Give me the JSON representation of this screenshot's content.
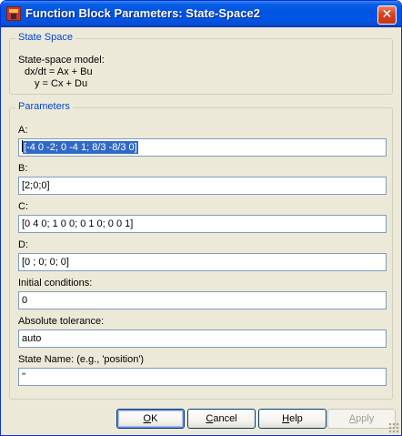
{
  "window": {
    "title": "Function Block Parameters: State-Space2",
    "close_label": "✕"
  },
  "state_space_group": {
    "legend": "State Space",
    "description_lines": [
      "State-space model:",
      "dx/dt = Ax + Bu",
      "y = Cx + Du"
    ]
  },
  "parameters_group": {
    "legend": "Parameters",
    "fields": [
      {
        "label": "A:",
        "value": "[-4 0 -2; 0 -4 1; 8/3 -8/3 0]",
        "selected": true
      },
      {
        "label": "B:",
        "value": "[2;0;0]"
      },
      {
        "label": "C:",
        "value": "[0 4 0; 1 0 0; 0 1 0; 0 0 1]"
      },
      {
        "label": "D:",
        "value": "[0 ; 0; 0; 0]"
      },
      {
        "label": "Initial conditions:",
        "value": "0"
      },
      {
        "label": "Absolute tolerance:",
        "value": "auto"
      },
      {
        "label": "State Name: (e.g., 'position')",
        "value": "''"
      }
    ]
  },
  "buttons": {
    "ok": {
      "pre": "",
      "mnemonic": "O",
      "post": "K"
    },
    "cancel": {
      "pre": "",
      "mnemonic": "C",
      "post": "ancel"
    },
    "help": {
      "pre": "",
      "mnemonic": "H",
      "post": "elp"
    },
    "apply": {
      "pre": "",
      "mnemonic": "A",
      "post": "pply",
      "enabled": false
    }
  }
}
